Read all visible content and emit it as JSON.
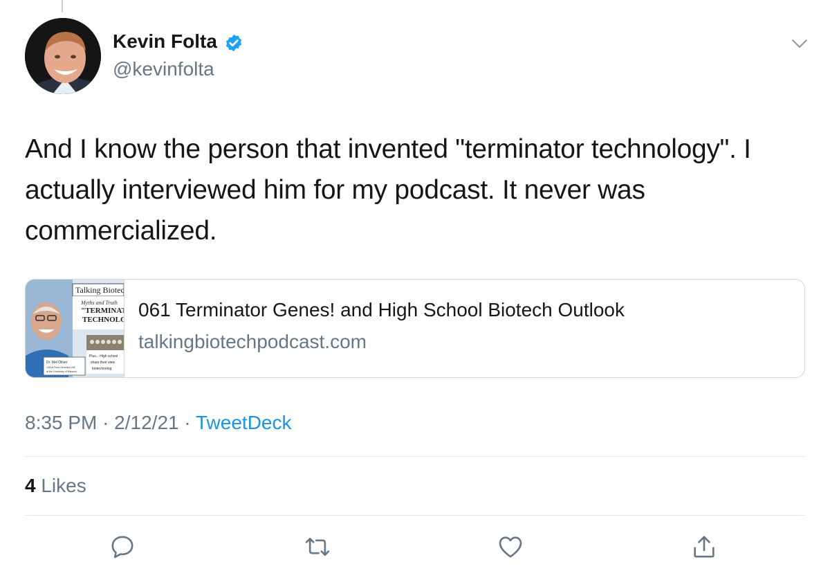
{
  "author": {
    "name": "Kevin Folta",
    "handle": "@kevinfolta",
    "verified": true
  },
  "tweet": {
    "lines": [
      "And I know the person that invented \"terminator technology\".  I",
      "actually interviewed him for my podcast. It never was",
      "commercialized."
    ]
  },
  "card": {
    "title": "061 Terminator Genes! and High School Biotech Outlook",
    "domain": "talkingbiotechpodcast.com",
    "thumbnail": {
      "banner": "Talking Biotec",
      "script_line": "Myths and Truth",
      "headline_1": "\"TERMINAT",
      "headline_2": "TECHNOLO",
      "caption_1": "Dr. Mel Oliver",
      "caption_2": "USDA Plant Genetics Unit",
      "caption_3": "at the University of Missouri",
      "plus_1": "Plus... High school",
      "plus_2": "share their view",
      "plus_3": "biotechnolog"
    }
  },
  "meta": {
    "time": "8:35 PM",
    "date": "2/12/21",
    "separator": "·",
    "source": "TweetDeck"
  },
  "stats": {
    "likes_count": "4",
    "likes_label": "Likes"
  },
  "actions": [
    "reply-icon",
    "retweet-icon",
    "like-icon",
    "share-icon"
  ],
  "colors": {
    "text": "#14171a",
    "secondary": "#657786",
    "link": "#1b95e0",
    "verified": "#1da1f2",
    "border": "#ccd6dd",
    "action_icon": "#657786"
  }
}
